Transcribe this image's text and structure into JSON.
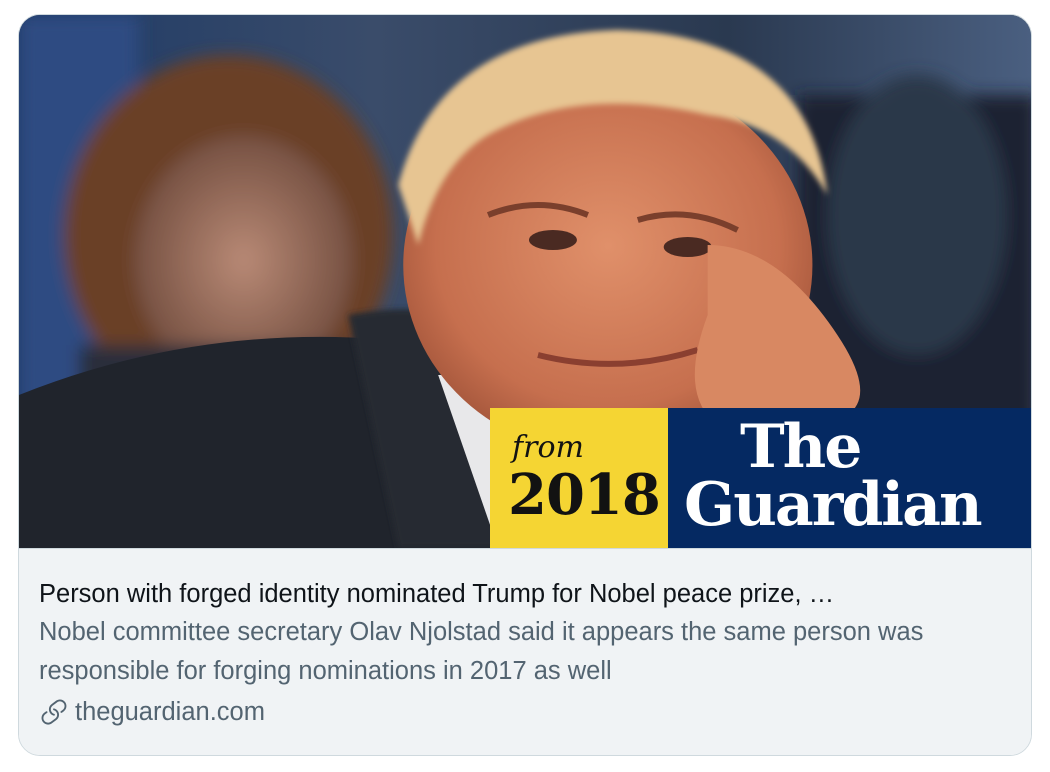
{
  "card": {
    "badge": {
      "from_label": "from",
      "year": "2018",
      "brand_line1": "The",
      "brand_line2": "Guardian"
    },
    "title": "Person with forged identity nominated Trump for Nobel peace prize, …",
    "description": "Nobel committee secretary Olav Njolstad said it appears the same person was responsible for forging nominations in 2017 as well",
    "domain": "theguardian.com",
    "domain_icon": "link-icon"
  },
  "colors": {
    "badge_yellow": "#f5d533",
    "badge_navy": "#052962",
    "meta_background": "#f0f3f5",
    "border": "#cfd9de",
    "title_text": "#0f1419",
    "secondary_text": "#536471"
  }
}
